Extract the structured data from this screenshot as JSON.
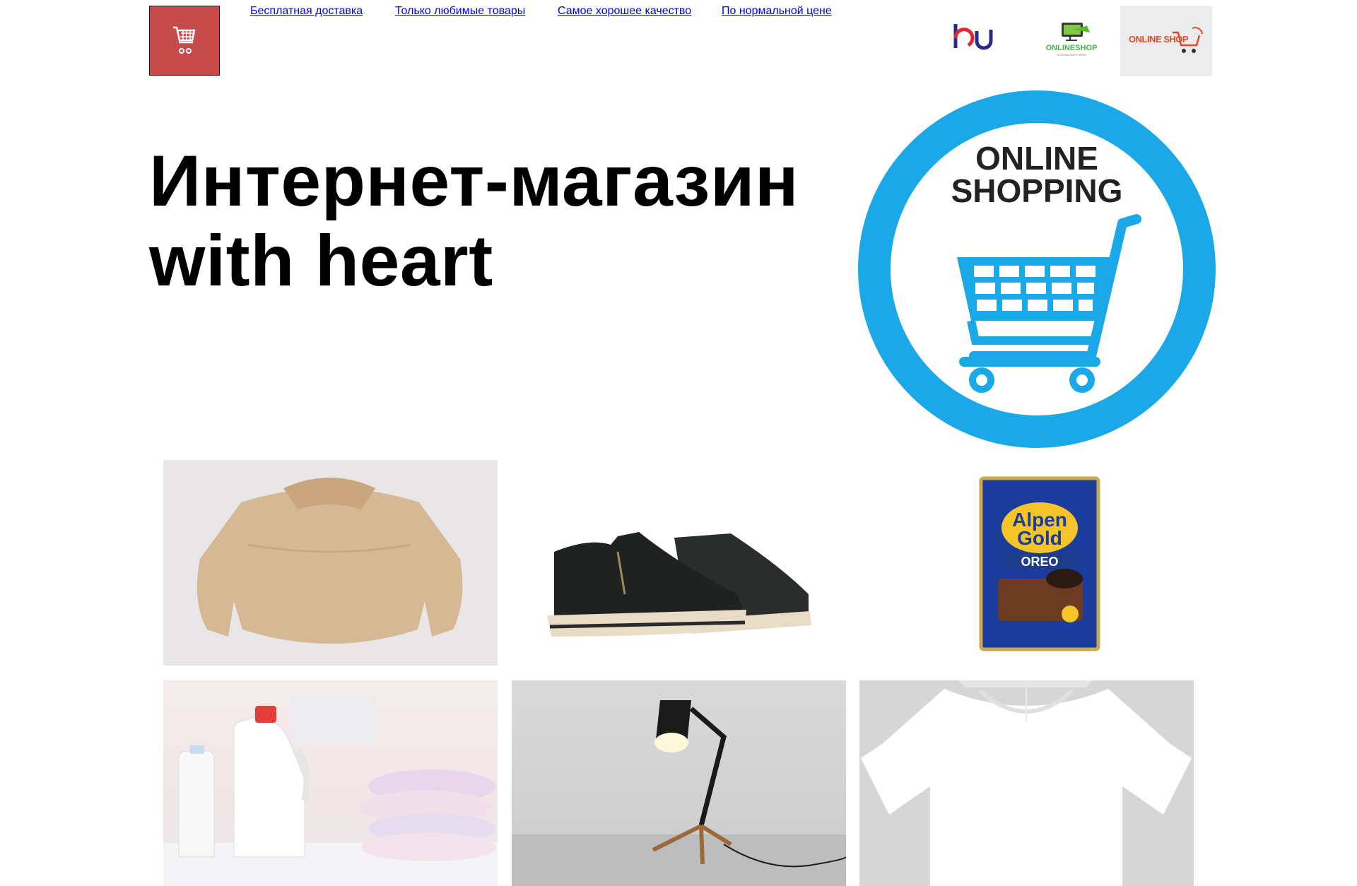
{
  "header": {
    "logo_icon": "shopping-cart-icon",
    "brand_color": "#c84b4b",
    "nav": [
      "Бесплатная доставка",
      "Только любимые товары",
      "Самое хорошее качество",
      "По нормальной цене"
    ],
    "partners": [
      {
        "text": "bu"
      },
      {
        "text": "ONLINESHOP",
        "sub": "SLOGAN GOES HERE"
      },
      {
        "text": "ONLINE SHOP"
      }
    ]
  },
  "hero": {
    "title_line1": "Интернет-магазин",
    "title_line2": "with heart",
    "badge": {
      "line1": "ONLINE",
      "line2": "SHOPPING",
      "color": "#1aa8e8"
    }
  },
  "products": [
    {
      "name": "sweater"
    },
    {
      "name": "sneakers"
    },
    {
      "name": "chocolate",
      "brand_line1": "Alpen",
      "brand_line2": "Gold",
      "flavor": "OREO"
    },
    {
      "name": "laundry-detergent"
    },
    {
      "name": "desk-lamp"
    },
    {
      "name": "white-t-shirt"
    }
  ]
}
